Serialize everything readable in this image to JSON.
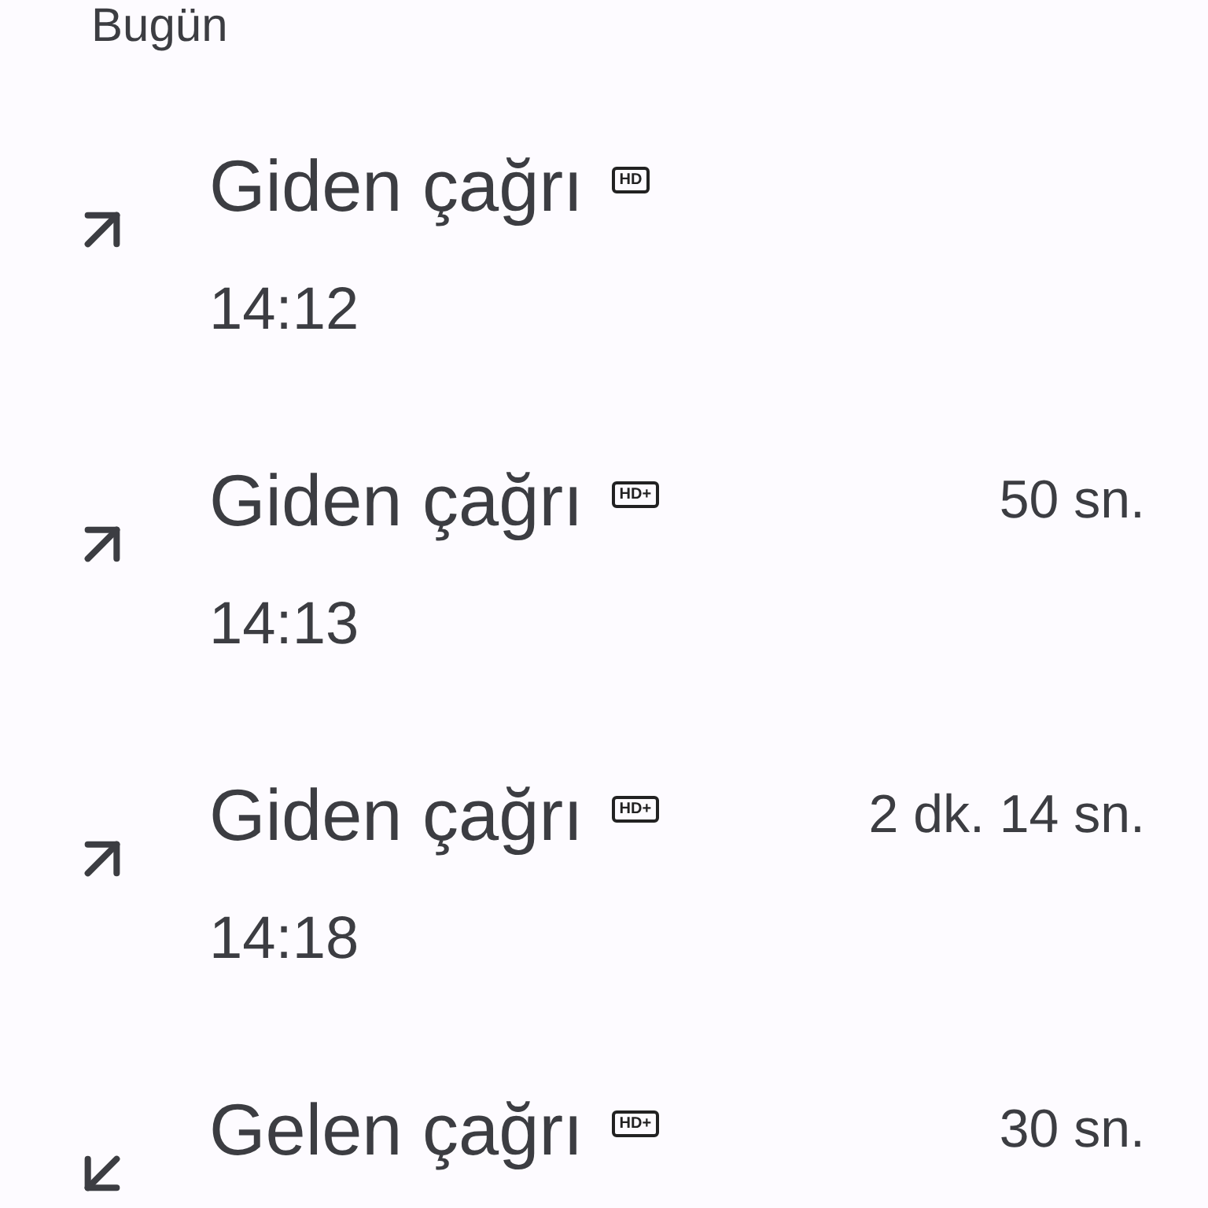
{
  "section_header": "Bugün",
  "calls": [
    {
      "kind": "outgoing",
      "title": "Giden çağrı",
      "badge": "HD",
      "time": "14:12"
    },
    {
      "kind": "outgoing",
      "title": "Giden çağrı",
      "badge": "HD+",
      "duration": "50 sn.",
      "time": "14:13"
    },
    {
      "kind": "outgoing",
      "title": "Giden çağrı",
      "badge": "HD+",
      "duration": "2 dk. 14 sn.",
      "time": "14:18"
    },
    {
      "kind": "incoming",
      "title": "Gelen çağrı",
      "badge": "HD+",
      "duration": "30 sn."
    }
  ]
}
